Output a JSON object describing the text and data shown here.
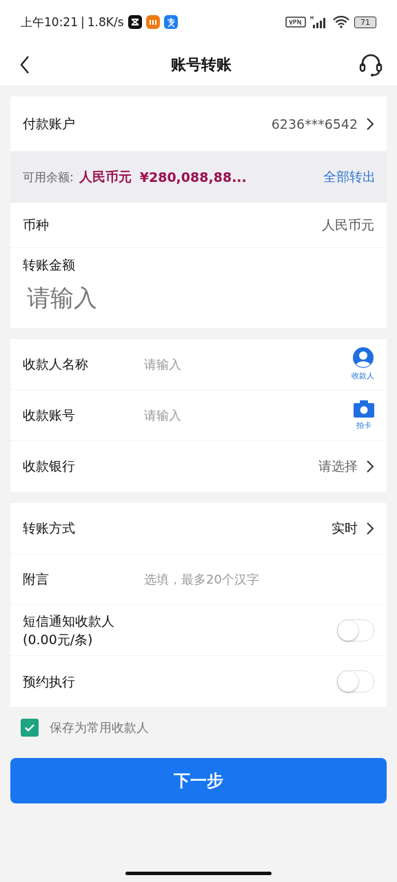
{
  "status_bar": {
    "time": "上午10:21",
    "separator": "|",
    "speed": "1.8K/s",
    "battery": "71"
  },
  "header": {
    "title": "账号转账"
  },
  "payer": {
    "label": "付款账户",
    "value": "6236***6542"
  },
  "balance": {
    "label": "可用余额:",
    "currency": "人民币元",
    "amount": "¥280,088,88...",
    "action": "全部转出"
  },
  "currency": {
    "label": "币种",
    "value": "人民币元"
  },
  "amount": {
    "label": "转账金额",
    "placeholder": "请输入"
  },
  "payee_rows": [
    {
      "kind": "input",
      "label": "收款人名称",
      "placeholder": "请输入",
      "side": {
        "label": "收款人"
      }
    },
    {
      "kind": "input",
      "label": "收款账号",
      "placeholder": "请输入",
      "side": {
        "label": "拍卡"
      }
    },
    {
      "kind": "select",
      "label": "收款银行",
      "value": "请选择",
      "muted": true
    }
  ],
  "option_rows": [
    {
      "kind": "select",
      "label": "转账方式",
      "value": "实时",
      "muted": false
    },
    {
      "kind": "input",
      "label": "附言",
      "placeholder": "选填，最多20个汉字"
    },
    {
      "kind": "toggle",
      "label": "短信通知收款人",
      "sublabel": "(0.00元/条)",
      "on": false
    },
    {
      "kind": "toggle",
      "label": "预约执行",
      "on": false
    }
  ],
  "save_payee": {
    "label": "保存为常用收款人",
    "checked": true
  },
  "next_button": {
    "label": "下一步"
  }
}
